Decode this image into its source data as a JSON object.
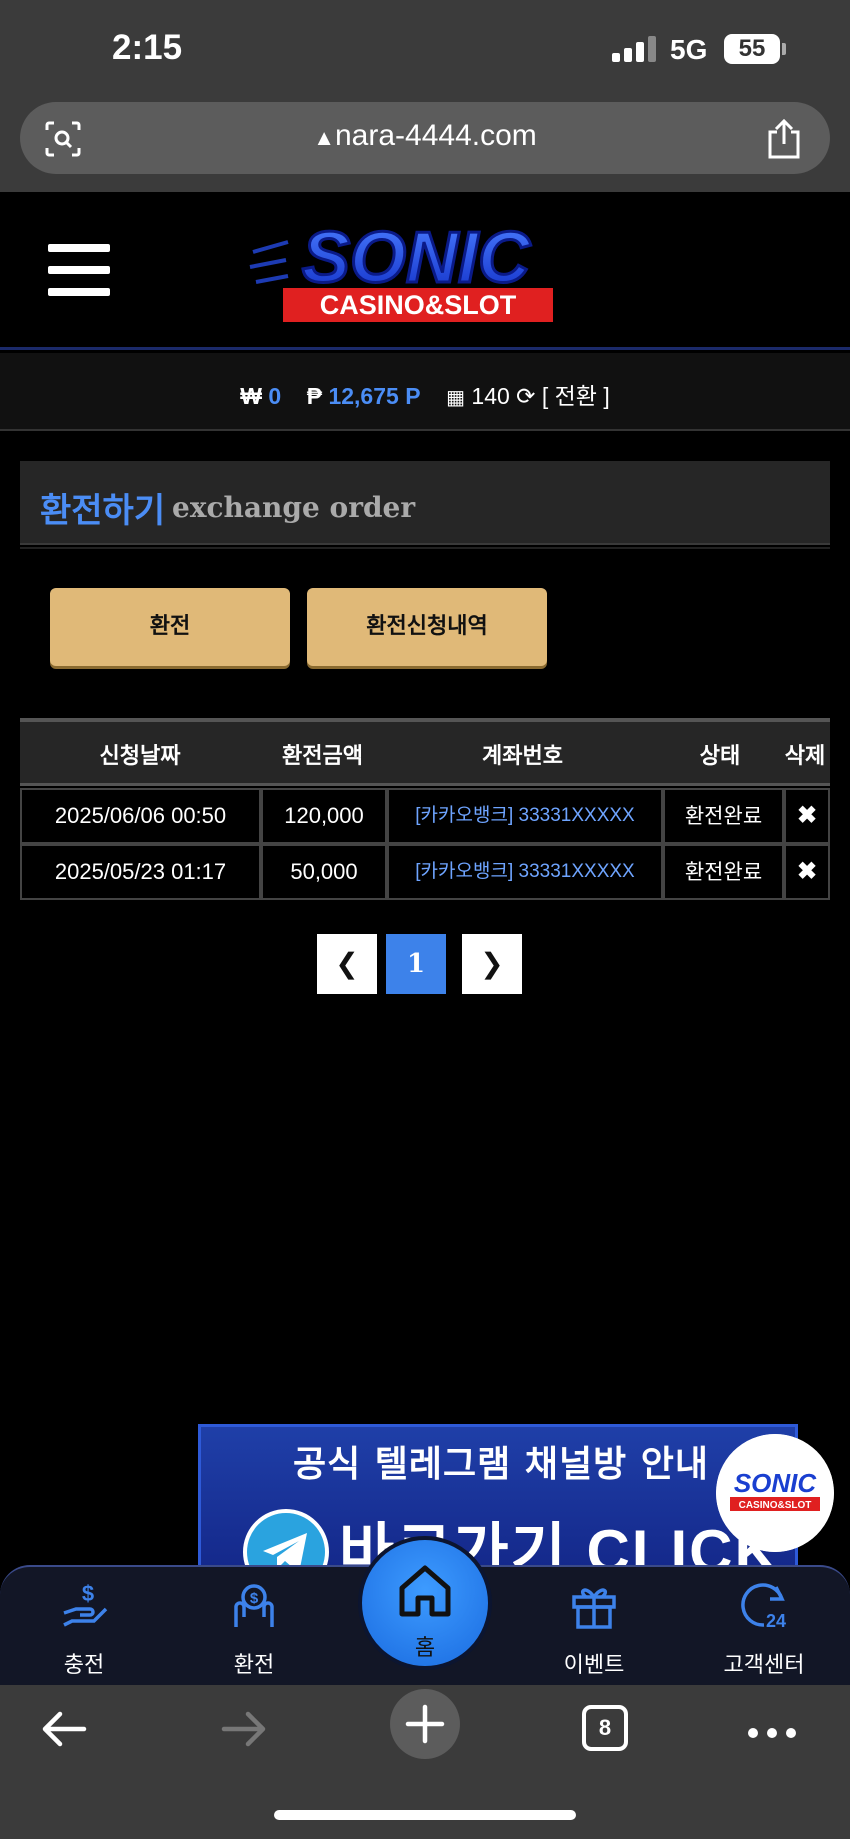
{
  "status_bar": {
    "time": "2:15",
    "network": "5G",
    "battery": "55"
  },
  "browser": {
    "url": "nara-4444.com",
    "tab_count": "8"
  },
  "header": {
    "logo_title": "SONIC",
    "logo_subtitle": "CASINO&SLOT"
  },
  "balance": {
    "won_symbol": "₩",
    "won_value": "0",
    "point_symbol": "₱",
    "point_value": "12,675 P",
    "chip_value": "140",
    "convert_label": "[ 전환 ]"
  },
  "section": {
    "title_ko": "환전하기",
    "title_en": "exchange order"
  },
  "buttons": {
    "exchange": "환전",
    "history": "환전신청내역"
  },
  "table": {
    "headers": [
      "신청날짜",
      "환전금액",
      "계좌번호",
      "상태",
      "삭제"
    ],
    "rows": [
      {
        "date": "2025/06/06 00:50",
        "amount": "120,000",
        "account": "[카카오뱅크] 33331XXXXX",
        "status": "환전완료",
        "delete": "✖"
      },
      {
        "date": "2025/05/23 01:17",
        "amount": "50,000",
        "account": "[카카오뱅크] 33331XXXXX",
        "status": "환전완료",
        "delete": "✖"
      }
    ]
  },
  "pagination": {
    "current": "1"
  },
  "banner": {
    "line1": "공식 텔레그램 채널방 안내",
    "line2": "바로가기 CLICK"
  },
  "float_logo": {
    "title": "SONIC",
    "subtitle": "CASINO&SLOT"
  },
  "bottom_nav": {
    "deposit": "충전",
    "withdraw": "환전",
    "home": "홈",
    "event": "이벤트",
    "support": "고객센터"
  },
  "colors": {
    "accent_blue": "#4b8df5",
    "button_gold": "#e0b978",
    "page_bg": "#000000"
  }
}
